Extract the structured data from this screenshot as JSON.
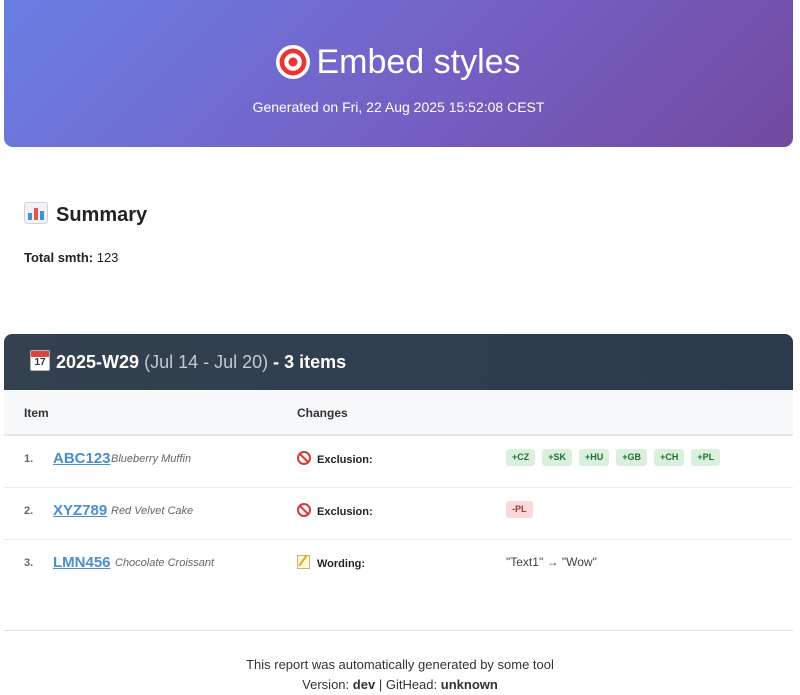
{
  "header": {
    "title": "Embed styles",
    "icon": "target-icon",
    "generated": "Generated on Fri, 22 Aug 2025 15:52:08 CEST",
    "gradient": [
      "#6a7fe4",
      "#734a9f"
    ]
  },
  "summary": {
    "title": "Summary",
    "icon": "bar-chart-icon",
    "total_label": "Total smth:",
    "total_value": "123"
  },
  "week": {
    "icon": "calendar-icon",
    "label": "2025-W29",
    "range": "(Jul 14 - Jul 20)",
    "count": "- 3 items",
    "columns": {
      "item": "Item",
      "changes": "Changes"
    },
    "rows": [
      {
        "num": "1.",
        "code": "ABC123",
        "desc": "Blueberry Muffin",
        "change_type": "Exclusion:",
        "change_icon": "no-entry-icon",
        "tags": [
          "+CZ",
          "+SK",
          "+HU",
          "+GB",
          "+CH",
          "+PL"
        ]
      },
      {
        "num": "2.",
        "code": "XYZ789",
        "desc": "Red Velvet Cake",
        "change_type": "Exclusion:",
        "change_icon": "no-entry-icon",
        "tags": [
          "-PL"
        ]
      },
      {
        "num": "3.",
        "code": "LMN456",
        "desc": "Chocolate Croissant",
        "change_type": "Wording:",
        "change_icon": "memo-icon",
        "wording": "\"Text1\" → \"Wow\""
      }
    ]
  },
  "footer": {
    "line1": "This report was automatically generated by some tool",
    "version_label": "Version:",
    "version_value": "dev",
    "separator": "|",
    "githead_label": "GitHead:",
    "githead_value": "unknown"
  },
  "colors": {
    "link": "#4a8ed0",
    "week_header": "#34414f",
    "tag_add_bg": "#d9f0dc",
    "tag_remove_bg": "#fbd9d9"
  }
}
